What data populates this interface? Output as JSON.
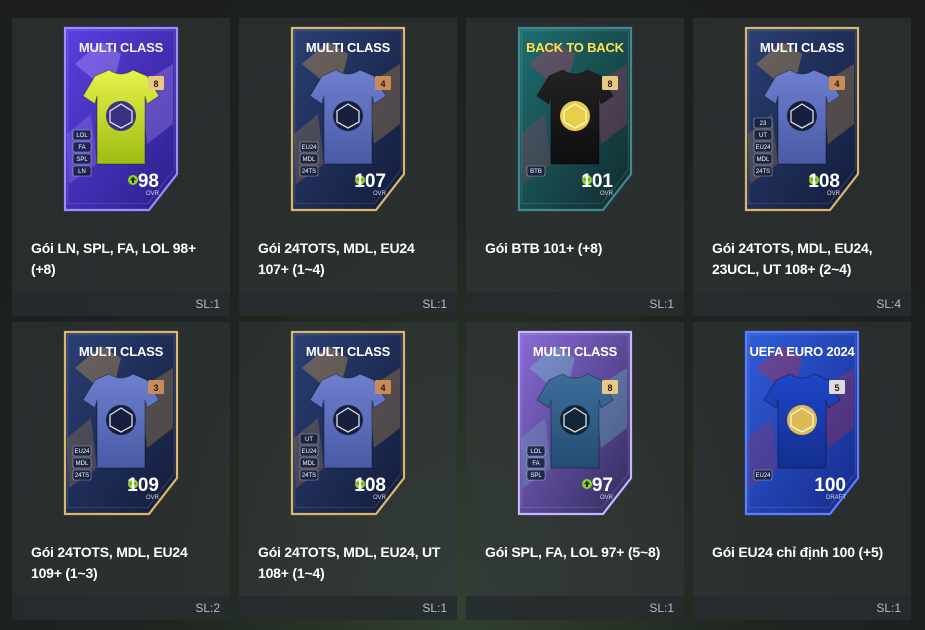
{
  "packs": [
    {
      "card_title": "MULTI CLASS",
      "title_color": "#f4f1e6",
      "slot": "8",
      "ovr": "98",
      "ovr_label": "OVR",
      "tags": [
        "LOL",
        "FA",
        "SPL",
        "LN"
      ],
      "style": "ln",
      "name": "Gói LN, SPL, FA, LOL 98+ (+8)",
      "qty": "SL:1"
    },
    {
      "card_title": "MULTI CLASS",
      "title_color": "#ffffff",
      "slot": "4",
      "ovr": "107",
      "ovr_label": "OVR",
      "tags": [
        "EU24",
        "MDL",
        "24TS"
      ],
      "style": "tots",
      "name": "Gói 24TOTS, MDL, EU24 107+ (1~4)",
      "qty": "SL:1"
    },
    {
      "card_title": "BACK TO BACK",
      "title_color": "#ffe34a",
      "slot": "8",
      "ovr": "101",
      "ovr_label": "OVR",
      "tags": [
        "BTB"
      ],
      "style": "btb",
      "name": "Gói BTB 101+ (+8)",
      "qty": "SL:1"
    },
    {
      "card_title": "MULTI CLASS",
      "title_color": "#ffffff",
      "slot": "4",
      "ovr": "108",
      "ovr_label": "OVR",
      "tags": [
        "23",
        "UT",
        "EU24",
        "MDL",
        "24TS"
      ],
      "style": "tots",
      "name": "Gói 24TOTS, MDL, EU24, 23UCL, UT 108+ (2~4)",
      "qty": "SL:4"
    },
    {
      "card_title": "MULTI CLASS",
      "title_color": "#ffffff",
      "slot": "3",
      "ovr": "109",
      "ovr_label": "OVR",
      "tags": [
        "EU24",
        "MDL",
        "24TS"
      ],
      "style": "tots",
      "name": "Gói 24TOTS, MDL, EU24 109+ (1~3)",
      "qty": "SL:2"
    },
    {
      "card_title": "MULTI CLASS",
      "title_color": "#ffffff",
      "slot": "4",
      "ovr": "108",
      "ovr_label": "OVR",
      "tags": [
        "UT",
        "EU24",
        "MDL",
        "24TS"
      ],
      "style": "tots",
      "name": "Gói 24TOTS, MDL, EU24, UT 108+ (1~4)",
      "qty": "SL:1"
    },
    {
      "card_title": "MULTI CLASS",
      "title_color": "#ffffff",
      "slot": "8",
      "ovr": "97",
      "ovr_label": "OVR",
      "tags": [
        "LOL",
        "FA",
        "SPL"
      ],
      "style": "spl",
      "name": "Gói SPL, FA, LOL 97+ (5~8)",
      "qty": "SL:1"
    },
    {
      "card_title": "UEFA EURO 2024",
      "title_color": "#ffffff",
      "slot": "5",
      "ovr": "100",
      "ovr_label": "DRAFT",
      "tags": [
        "EU24"
      ],
      "style": "euro",
      "name": "Gói EU24 chỉ định 100 (+5)",
      "qty": "SL:1"
    }
  ],
  "colors": {
    "ovr_arrow": "#8dd420",
    "gold_frame": "#d9b86a"
  }
}
